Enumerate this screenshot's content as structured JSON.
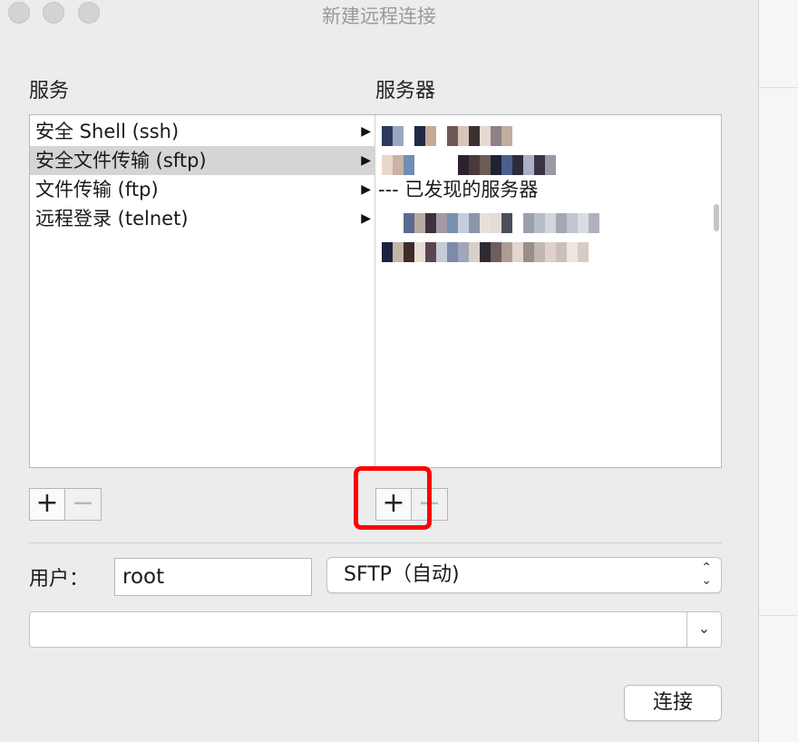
{
  "window": {
    "title": "新建远程连接"
  },
  "services": {
    "label": "服务",
    "items": [
      {
        "label": "安全 Shell (ssh)",
        "selected": false
      },
      {
        "label": "安全文件传输 (sftp)",
        "selected": true
      },
      {
        "label": "文件传输 (ftp)",
        "selected": false
      },
      {
        "label": "远程登录 (telnet)",
        "selected": false
      }
    ],
    "arrow_icon": "▶"
  },
  "servers": {
    "label": "服务器",
    "discovered_header": "--- 已发现的服务器"
  },
  "buttons": {
    "add": "+",
    "remove": "−",
    "connect": "连接"
  },
  "user": {
    "label": "用户：",
    "value": "root"
  },
  "protocol": {
    "selected": "SFTP（自动)",
    "icon": "up-down-chevron"
  },
  "address": {
    "value": "",
    "icon": "chevron-down"
  },
  "colors": {
    "highlight": "#ff0000",
    "selection": "#d5d5d5"
  }
}
